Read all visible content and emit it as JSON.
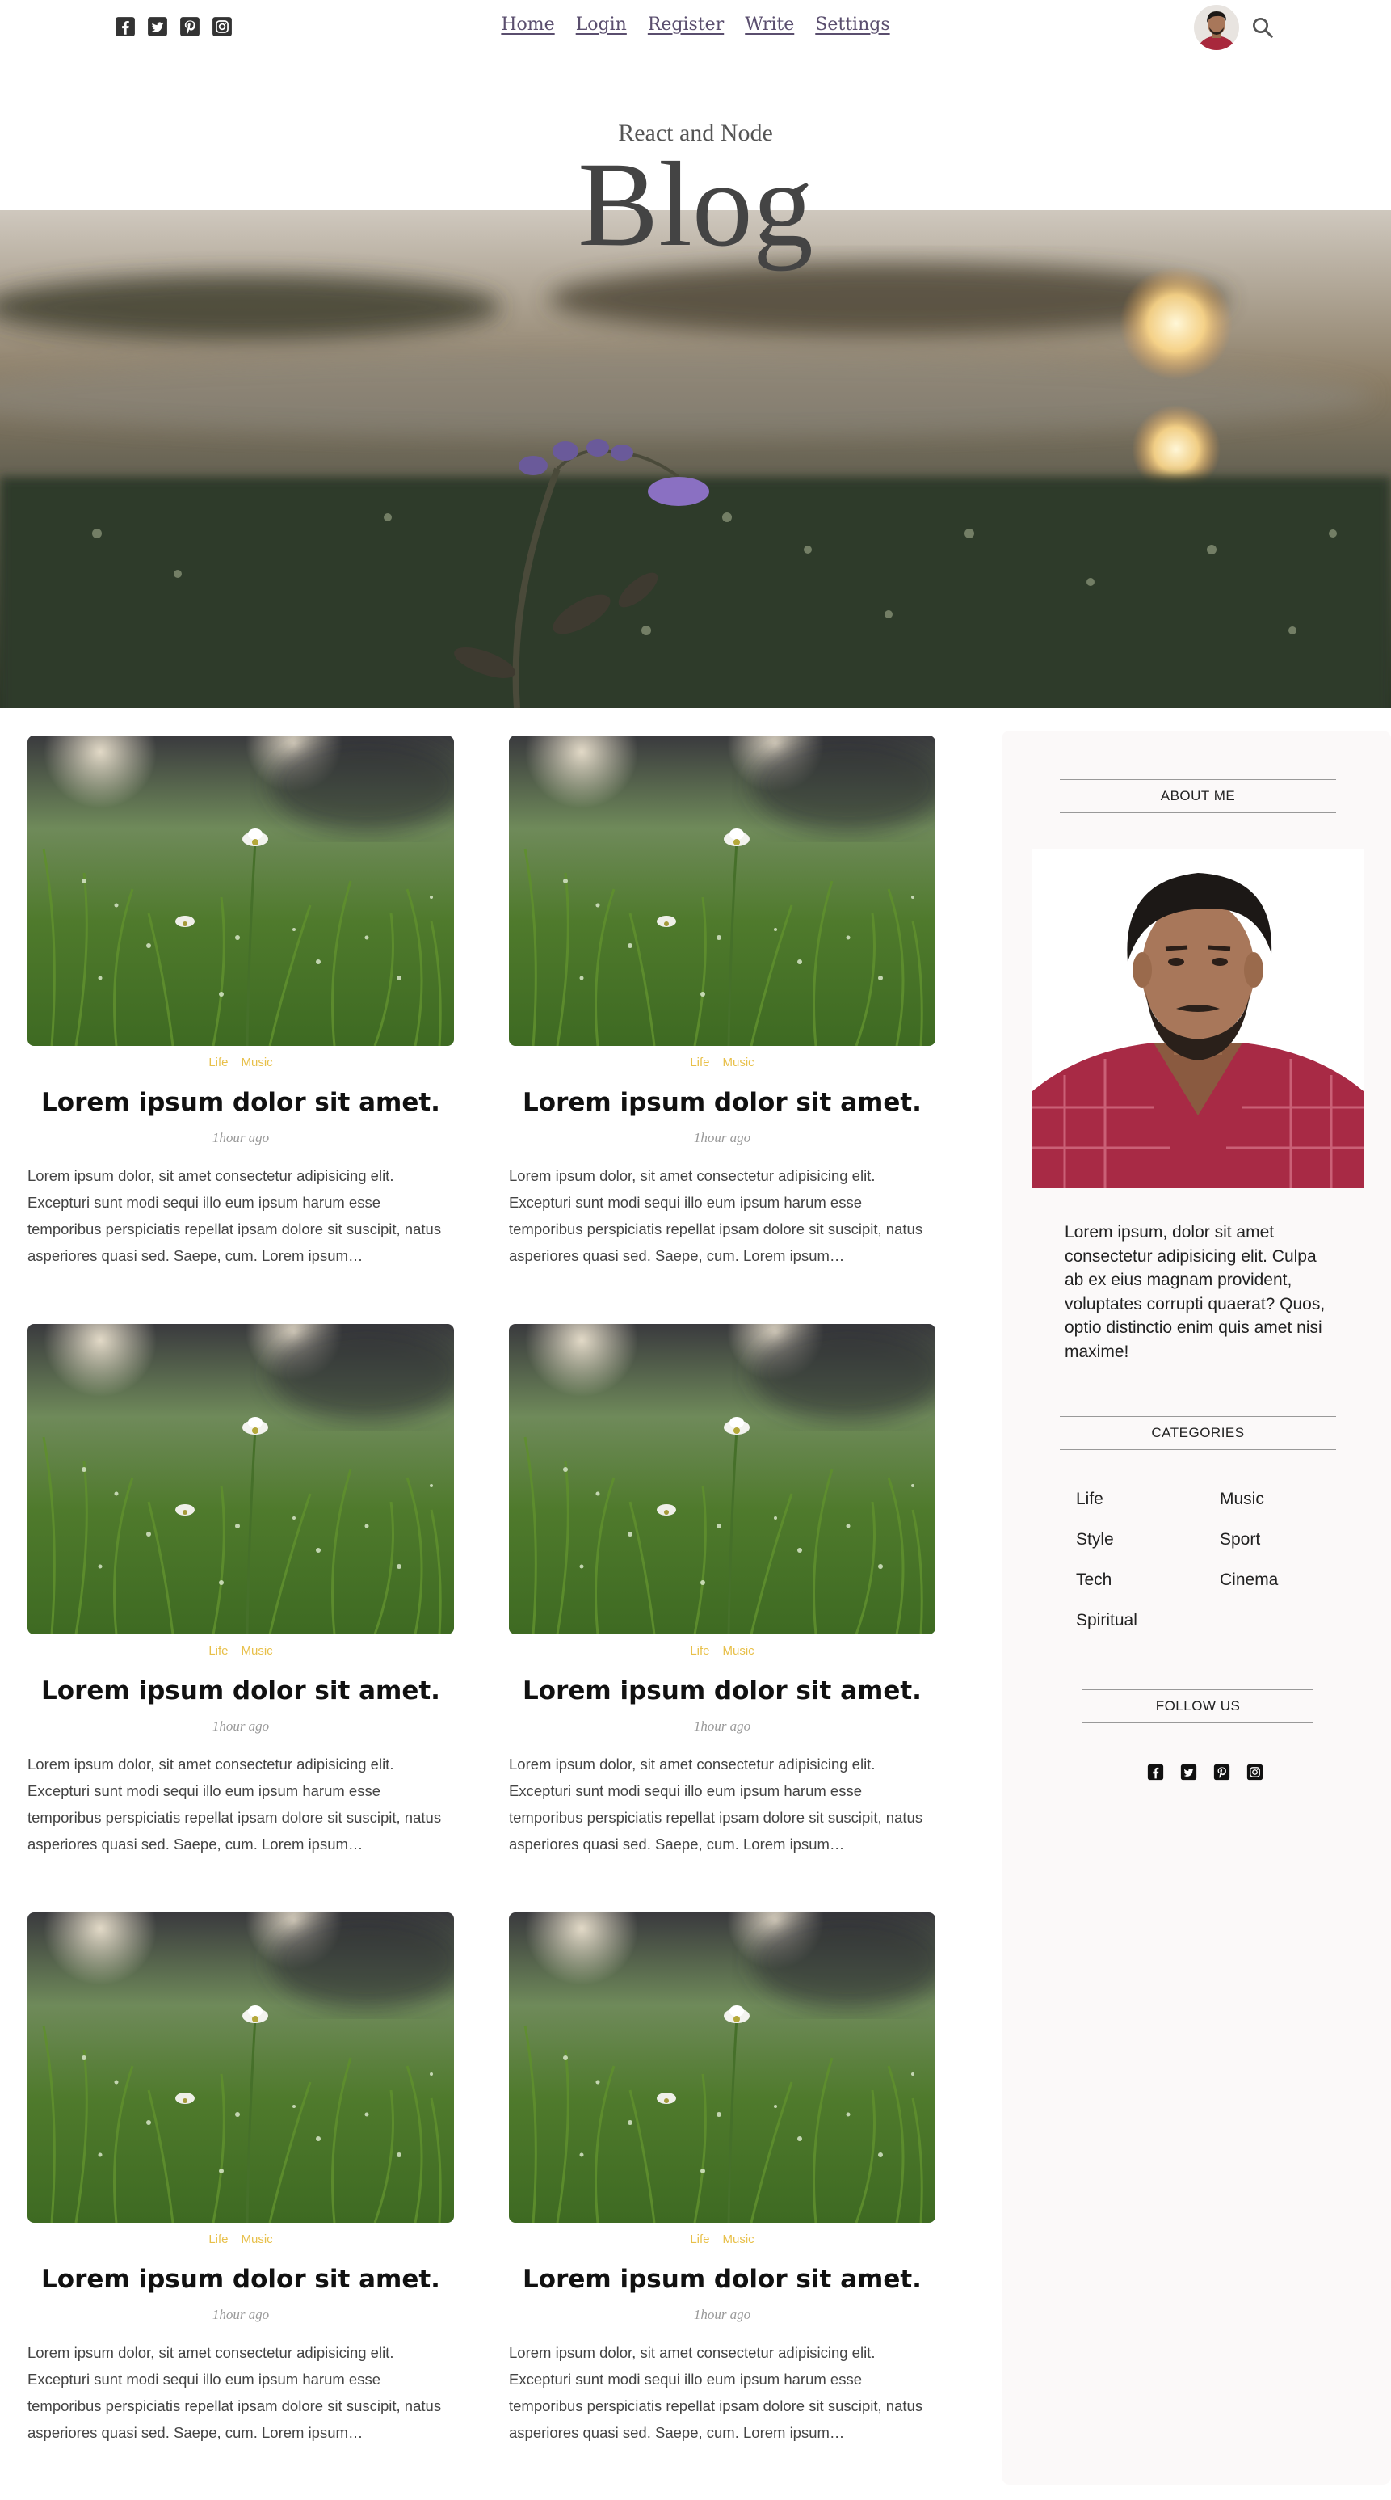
{
  "topbar": {
    "social_icons": [
      "facebook-square-icon",
      "twitter-square-icon",
      "pinterest-square-icon",
      "instagram-square-icon"
    ],
    "nav": [
      "Home",
      "Login",
      "Register",
      "Write",
      "Settings"
    ],
    "search_icon": "search-icon"
  },
  "header": {
    "small": "React and Node",
    "large": "Blog"
  },
  "posts": [
    {
      "cats": [
        "Life",
        "Music"
      ],
      "title": "Lorem ipsum dolor sit amet.",
      "date": "1hour ago",
      "desc": "Lorem ipsum dolor, sit amet consectetur adipisicing elit. Excepturi sunt modi sequi illo eum ipsum harum esse temporibus perspiciatis repellat ipsam dolore sit suscipit, natus asperiores quasi sed. Saepe, cum. Lorem ipsum…"
    },
    {
      "cats": [
        "Life",
        "Music"
      ],
      "title": "Lorem ipsum dolor sit amet.",
      "date": "1hour ago",
      "desc": "Lorem ipsum dolor, sit amet consectetur adipisicing elit. Excepturi sunt modi sequi illo eum ipsum harum esse temporibus perspiciatis repellat ipsam dolore sit suscipit, natus asperiores quasi sed. Saepe, cum. Lorem ipsum…"
    },
    {
      "cats": [
        "Life",
        "Music"
      ],
      "title": "Lorem ipsum dolor sit amet.",
      "date": "1hour ago",
      "desc": "Lorem ipsum dolor, sit amet consectetur adipisicing elit. Excepturi sunt modi sequi illo eum ipsum harum esse temporibus perspiciatis repellat ipsam dolore sit suscipit, natus asperiores quasi sed. Saepe, cum. Lorem ipsum…"
    },
    {
      "cats": [
        "Life",
        "Music"
      ],
      "title": "Lorem ipsum dolor sit amet.",
      "date": "1hour ago",
      "desc": "Lorem ipsum dolor, sit amet consectetur adipisicing elit. Excepturi sunt modi sequi illo eum ipsum harum esse temporibus perspiciatis repellat ipsam dolore sit suscipit, natus asperiores quasi sed. Saepe, cum. Lorem ipsum…"
    },
    {
      "cats": [
        "Life",
        "Music"
      ],
      "title": "Lorem ipsum dolor sit amet.",
      "date": "1hour ago",
      "desc": "Lorem ipsum dolor, sit amet consectetur adipisicing elit. Excepturi sunt modi sequi illo eum ipsum harum esse temporibus perspiciatis repellat ipsam dolore sit suscipit, natus asperiores quasi sed. Saepe, cum. Lorem ipsum…"
    },
    {
      "cats": [
        "Life",
        "Music"
      ],
      "title": "Lorem ipsum dolor sit amet.",
      "date": "1hour ago",
      "desc": "Lorem ipsum dolor, sit amet consectetur adipisicing elit. Excepturi sunt modi sequi illo eum ipsum harum esse temporibus perspiciatis repellat ipsam dolore sit suscipit, natus asperiores quasi sed. Saepe, cum. Lorem ipsum…"
    }
  ],
  "sidebar": {
    "about_title": "ABOUT ME",
    "about_text": "Lorem ipsum, dolor sit amet consectetur adipisicing elit. Culpa ab ex eius magnam provident, voluptates corrupti quaerat? Quos, optio distinctio enim quis amet nisi maxime!",
    "categories_title": "CATEGORIES",
    "categories": [
      "Life",
      "Music",
      "Style",
      "Sport",
      "Tech",
      "Cinema",
      "Spiritual"
    ],
    "follow_title": "FOLLOW US",
    "social_icons": [
      "facebook-square-icon",
      "twitter-square-icon",
      "pinterest-square-icon",
      "instagram-square-icon"
    ]
  },
  "colors": {
    "category_accent": "#e8c04a",
    "nav_link": "#5a4e6e",
    "sidebar_bg": "#fbf9f9"
  }
}
